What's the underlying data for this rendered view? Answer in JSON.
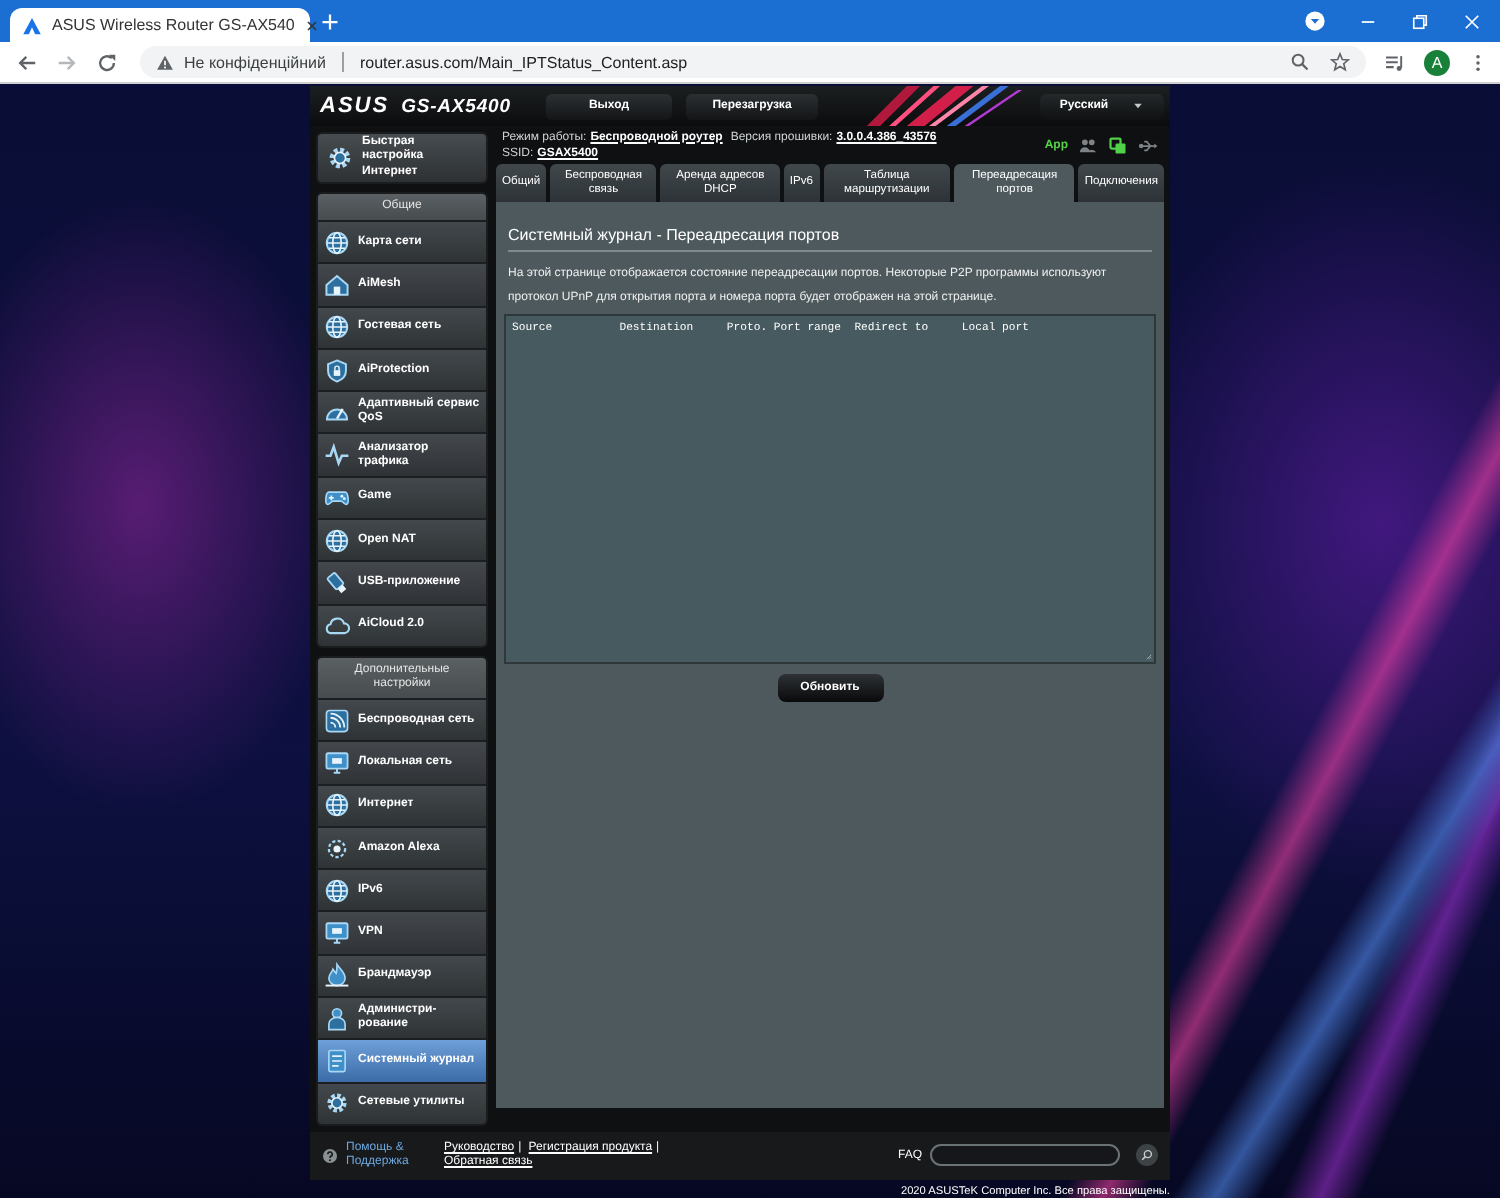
{
  "browser": {
    "tab_title": "ASUS Wireless Router GS-AX540",
    "security_label": "Не конфіденційний",
    "url": "router.asus.com/Main_IPTStatus_Content.asp",
    "profile_initial": "A"
  },
  "header": {
    "logo": "ASUS",
    "model": "GS-AX5400",
    "buttons": [
      "Выход",
      "Перезагрузка"
    ],
    "language": "Русский"
  },
  "info": {
    "mode_label": "Режим работы:",
    "mode_value": "Беспроводной роутер",
    "firmware_label": "Версия прошивки:",
    "firmware_value": "3.0.0.4.386_43576",
    "ssid_label": "SSID:",
    "ssid_value": "GSAX5400"
  },
  "status": {
    "app_label": "App"
  },
  "sidebar": {
    "quick_setup": "Быстрая настройка Интернет",
    "groups": [
      {
        "title": "Общие",
        "items": [
          {
            "label": "Карта сети",
            "selected": false
          },
          {
            "label": "AiMesh",
            "selected": false
          },
          {
            "label": "Гостевая сеть",
            "selected": false
          },
          {
            "label": "AiProtection",
            "selected": false
          },
          {
            "label": "Адаптивный сервис QoS",
            "selected": false
          },
          {
            "label": "Анализатор трафика",
            "selected": false
          },
          {
            "label": "Game",
            "selected": false
          },
          {
            "label": "Open NAT",
            "selected": false
          },
          {
            "label": "USB-приложение",
            "selected": false
          },
          {
            "label": "AiCloud 2.0",
            "selected": false
          }
        ]
      },
      {
        "title": "Дополнительные настройки",
        "items": [
          {
            "label": "Беспроводная сеть",
            "selected": false
          },
          {
            "label": "Локальная сеть",
            "selected": false
          },
          {
            "label": "Интернет",
            "selected": false
          },
          {
            "label": "Amazon Alexa",
            "selected": false
          },
          {
            "label": "IPv6",
            "selected": false
          },
          {
            "label": "VPN",
            "selected": false
          },
          {
            "label": "Брандмауэр",
            "selected": false
          },
          {
            "label": "Администри-рование",
            "selected": false
          },
          {
            "label": "Системный журнал",
            "selected": true
          },
          {
            "label": "Сетевые утилиты",
            "selected": false
          }
        ]
      }
    ]
  },
  "tabs": [
    {
      "label": "Общий",
      "selected": false
    },
    {
      "label": "Беспроводная связь",
      "selected": false
    },
    {
      "label": "Аренда адресов DHCP",
      "selected": false
    },
    {
      "label": "IPv6",
      "selected": false
    },
    {
      "label": "Таблица маршрутизации",
      "selected": false
    },
    {
      "label": "Переадресация портов",
      "selected": true
    },
    {
      "label": "Подключения",
      "selected": false
    }
  ],
  "panel": {
    "title": "Системный журнал - Переадресация портов",
    "description": "На этой странице отображается состояние переадресации портов. Некоторые P2P программы используют протокол UPnP для открытия порта и номера порта будет отображен на этой странице.",
    "log_text": "Source          Destination     Proto. Port range  Redirect to     Local port",
    "refresh_button": "Обновить"
  },
  "footer": {
    "help": "Помощь & Поддержка",
    "links": [
      "Руководство",
      "Регистрация продукта",
      "Обратная связь"
    ],
    "link_separator": "|",
    "faq_label": "FAQ",
    "copyright": "2020 ASUSTeK Computer Inc. Все права защищены."
  }
}
